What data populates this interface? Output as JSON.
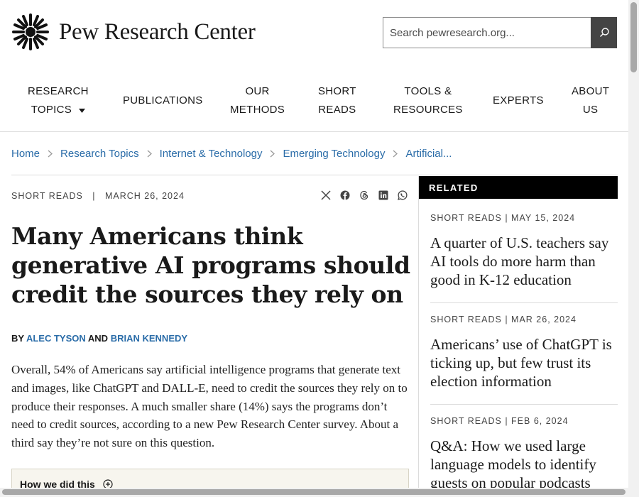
{
  "header": {
    "logo_text": "Pew Research Center",
    "search": {
      "placeholder": "Search pewresearch.org..."
    }
  },
  "nav": [
    {
      "line1": "RESEARCH",
      "line2": "TOPICS",
      "has_dropdown": true
    },
    {
      "line1": "PUBLICATIONS",
      "line2": ""
    },
    {
      "line1": "OUR",
      "line2": "METHODS"
    },
    {
      "line1": "SHORT",
      "line2": "READS"
    },
    {
      "line1": "TOOLS &",
      "line2": "RESOURCES"
    },
    {
      "line1": "EXPERTS",
      "line2": ""
    },
    {
      "line1": "ABOUT",
      "line2": "US"
    }
  ],
  "breadcrumb": [
    "Home",
    "Research Topics",
    "Internet & Technology",
    "Emerging Technology",
    "Artificial..."
  ],
  "article": {
    "category": "SHORT READS",
    "date": "MARCH 26, 2024",
    "title": "Many Americans think generative AI programs should credit the sources they rely on",
    "byline_prefix": "BY",
    "author1": "ALEC TYSON",
    "byline_and": "AND",
    "author2": "BRIAN KENNEDY",
    "body": "Overall, 54% of Americans say artificial intelligence programs that generate text and images, like ChatGPT and DALL-E, need to credit the sources they rely on to produce their responses. A much smaller share (14%) says the programs don’t need to credit sources, according to a new Pew Research Center survey. About a third say they’re not sure on this question.",
    "how_we_did_this": "How we did this"
  },
  "share_icons": [
    "x-icon",
    "facebook-icon",
    "threads-icon",
    "linkedin-icon",
    "whatsapp-icon"
  ],
  "sidebar": {
    "header": "RELATED",
    "items": [
      {
        "category": "SHORT READS",
        "date": "MAY 15, 2024",
        "title": "A quarter of U.S. teachers say AI tools do more harm than good in K-12 education"
      },
      {
        "category": "SHORT READS",
        "date": "MAR 26, 2024",
        "title": "Americans’ use of ChatGPT is ticking up, but few trust its election information"
      },
      {
        "category": "SHORT READS",
        "date": "FEB 6, 2024",
        "title": "Q&A: How we used large language models to identify guests on popular podcasts"
      }
    ]
  },
  "colors": {
    "link": "#2a6ca8",
    "related_header_bg": "#000000",
    "search_button_bg": "#444444",
    "howbox_bg": "#f7f5ee"
  }
}
